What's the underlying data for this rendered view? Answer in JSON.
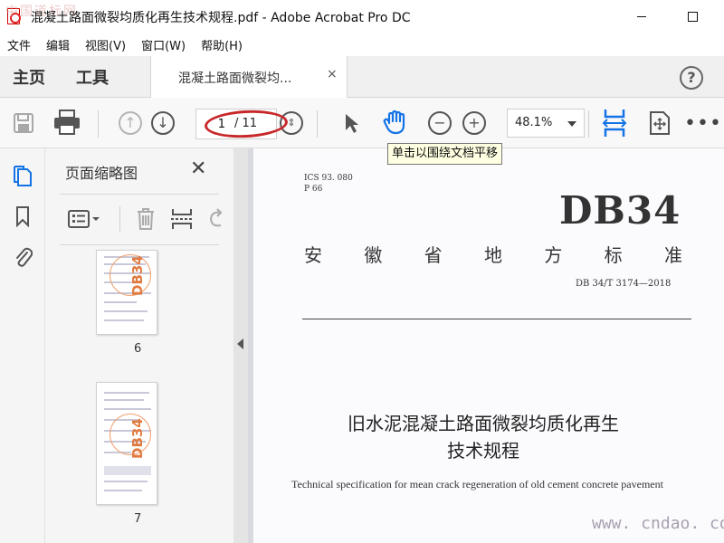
{
  "window": {
    "title": "混凝土路面微裂均质化再生技术规程.pdf - Adobe Acrobat Pro DC",
    "watermark_top": "中国道标网"
  },
  "menu": [
    "文件",
    "编辑",
    "视图(V)",
    "窗口(W)",
    "帮助(H)"
  ],
  "tabs": {
    "home": "主页",
    "tools": "工具",
    "document": "混凝土路面微裂均...",
    "close_glyph": "×"
  },
  "help_glyph": "?",
  "toolbar": {
    "current_page": "1",
    "total_pages": "/ 11",
    "zoom": "48.1%",
    "tooltip": "单击以围绕文档平移"
  },
  "thumbnails": {
    "title": "页面缩略图",
    "close_glyph": "✕",
    "pages": [
      {
        "number": "6",
        "stamp": "DB34"
      },
      {
        "number": "7",
        "stamp": "DB34"
      }
    ]
  },
  "document": {
    "ics": "ICS 93. 080",
    "p": "P 66",
    "db": "DB34",
    "province_chars": [
      "安",
      "徽",
      "省",
      "地",
      "方",
      "标",
      "准"
    ],
    "code": "DB 34/T 3174—2018",
    "title_cn_line1": "旧水泥混凝土路面微裂均质化再生",
    "title_cn_line2": "技术规程",
    "title_en": "Technical specification for mean crack regeneration of old cement concrete pavement",
    "watermark": "www. cndao. com"
  },
  "colors": {
    "annotation_red": "#c8282a",
    "acrobat_blue": "#1473e6",
    "stamp_orange": "#e07a40"
  }
}
